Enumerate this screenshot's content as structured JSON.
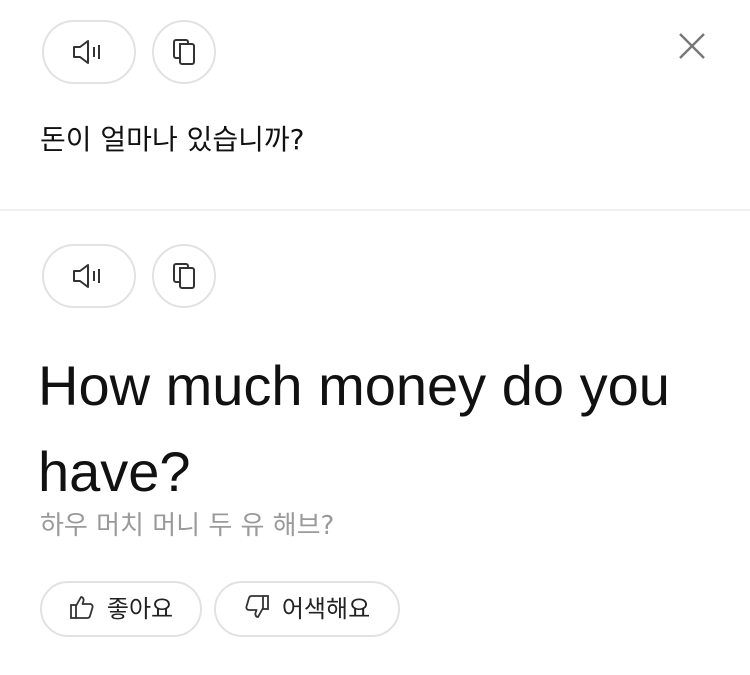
{
  "source": {
    "text": "돈이 얼마나 있습니까?",
    "speak_icon": "speaker-icon",
    "copy_icon": "copy-icon",
    "close_icon": "close-icon"
  },
  "target": {
    "text": "How much money do you have?",
    "romanization": "하우 머치 머니 두 유 해브?",
    "speak_icon": "speaker-icon",
    "copy_icon": "copy-icon"
  },
  "feedback": {
    "like_label": "좋아요",
    "like_icon": "thumbs-up-icon",
    "dislike_label": "어색해요",
    "dislike_icon": "thumbs-down-icon"
  },
  "colors": {
    "border": "#e2e2e2",
    "divider": "#efefef",
    "text": "#111111",
    "muted": "#9a9a9a",
    "icon": "#333333"
  }
}
